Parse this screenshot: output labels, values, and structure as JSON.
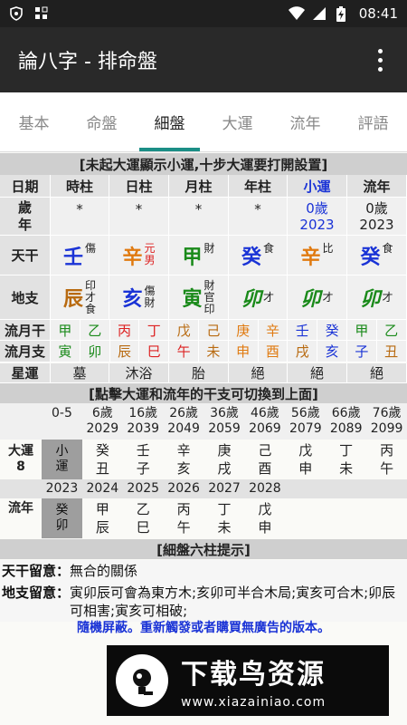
{
  "status": {
    "time": "08:41"
  },
  "app": {
    "title": "論八字 - 排命盤"
  },
  "tabs": [
    "基本",
    "命盤",
    "細盤",
    "大運",
    "流年",
    "評語"
  ],
  "active_tab": 2,
  "notice1": "[未起大運顯示小運,十步大運要打開設置]",
  "pillars": {
    "headers": [
      "日期",
      "時柱",
      "日柱",
      "月柱",
      "年柱",
      "小運",
      "流年"
    ],
    "age_label": "歲年",
    "ages": [
      "*",
      "*",
      "*",
      "*"
    ],
    "xiaoyun": {
      "age": "0歲",
      "year": "2023"
    },
    "liunian": {
      "age": "0歲",
      "year": "2023"
    },
    "tiangan_label": "天干",
    "tiangan": [
      {
        "char": "壬",
        "color": "#1a33d6",
        "sub": "傷",
        "sub2": ""
      },
      {
        "char": "辛",
        "color": "#e07a10",
        "sub": "元",
        "sub2": "男",
        "red": true
      },
      {
        "char": "甲",
        "color": "#1a8a1a",
        "sub": "財",
        "sub2": ""
      },
      {
        "char": "癸",
        "color": "#1a33d6",
        "sub": "食",
        "sub2": ""
      },
      {
        "char": "辛",
        "color": "#e07a10",
        "sub": "比",
        "sub2": ""
      },
      {
        "char": "癸",
        "color": "#1a33d6",
        "sub": "食",
        "sub2": ""
      }
    ],
    "dizhi_label": "地支",
    "dizhi": [
      {
        "char": "辰",
        "color": "#b86a10",
        "sub": [
          "印",
          "才",
          "食"
        ]
      },
      {
        "char": "亥",
        "color": "#1a33d6",
        "sub": [
          "傷",
          "財"
        ]
      },
      {
        "char": "寅",
        "color": "#1a8a1a",
        "sub": [
          "財",
          "官",
          "印"
        ]
      },
      {
        "char": "卯",
        "color": "#1a8a1a",
        "sub": [
          "才"
        ]
      },
      {
        "char": "卯",
        "color": "#1a8a1a",
        "sub": [
          "才"
        ]
      },
      {
        "char": "卯",
        "color": "#1a8a1a",
        "sub": [
          "才"
        ]
      }
    ]
  },
  "flow": {
    "gan_label": "流月干",
    "zhi_label": "流月支",
    "gan": [
      {
        "c": "甲",
        "col": "#1a8a1a"
      },
      {
        "c": "乙",
        "col": "#1a8a1a"
      },
      {
        "c": "丙",
        "col": "#d22"
      },
      {
        "c": "丁",
        "col": "#d22"
      },
      {
        "c": "戊",
        "col": "#b86a10"
      },
      {
        "c": "己",
        "col": "#b86a10"
      },
      {
        "c": "庚",
        "col": "#e07a10"
      },
      {
        "c": "辛",
        "col": "#e07a10"
      },
      {
        "c": "壬",
        "col": "#1a33d6"
      },
      {
        "c": "癸",
        "col": "#1a33d6"
      },
      {
        "c": "甲",
        "col": "#1a8a1a"
      },
      {
        "c": "乙",
        "col": "#1a8a1a"
      }
    ],
    "zhi": [
      {
        "c": "寅",
        "col": "#1a8a1a"
      },
      {
        "c": "卯",
        "col": "#1a8a1a"
      },
      {
        "c": "辰",
        "col": "#b86a10"
      },
      {
        "c": "巳",
        "col": "#d22"
      },
      {
        "c": "午",
        "col": "#d22"
      },
      {
        "c": "未",
        "col": "#b86a10"
      },
      {
        "c": "申",
        "col": "#e07a10"
      },
      {
        "c": "酉",
        "col": "#e07a10"
      },
      {
        "c": "戌",
        "col": "#b86a10"
      },
      {
        "c": "亥",
        "col": "#1a33d6"
      },
      {
        "c": "子",
        "col": "#1a33d6"
      },
      {
        "c": "丑",
        "col": "#b86a10"
      }
    ]
  },
  "xingyun": {
    "label": "星運",
    "values": [
      "墓",
      "沐浴",
      "胎",
      "絕",
      "絕",
      "絕"
    ]
  },
  "notice2": "[點擊大運和流年的干支可切換到上面]",
  "dayun": {
    "ranges": [
      {
        "age": "0-5",
        "year": ""
      },
      {
        "age": "6歲",
        "year": "2029"
      },
      {
        "age": "16歲",
        "year": "2039"
      },
      {
        "age": "26歲",
        "year": "2049"
      },
      {
        "age": "36歲",
        "year": "2059"
      },
      {
        "age": "46歲",
        "year": "2069"
      },
      {
        "age": "56歲",
        "year": "2079"
      },
      {
        "age": "66歲",
        "year": "2089"
      },
      {
        "age": "76歲",
        "year": "2099"
      }
    ],
    "label": "大運",
    "num": "8",
    "first": [
      "小",
      "運"
    ],
    "pillars": [
      [
        "癸",
        "丑"
      ],
      [
        "壬",
        "子"
      ],
      [
        "辛",
        "亥"
      ],
      [
        "庚",
        "戌"
      ],
      [
        "己",
        "酉"
      ],
      [
        "戊",
        "申"
      ],
      [
        "丁",
        "未"
      ],
      [
        "丙",
        "午"
      ]
    ]
  },
  "liunian_row": {
    "years": [
      "2023",
      "2024",
      "2025",
      "2026",
      "2027",
      "2028"
    ],
    "label": "流年",
    "first": [
      "癸",
      "卯"
    ],
    "pillars": [
      [
        "甲",
        "辰"
      ],
      [
        "乙",
        "巳"
      ],
      [
        "丙",
        "午"
      ],
      [
        "丁",
        "未"
      ],
      [
        "戊",
        "申"
      ]
    ]
  },
  "notice3": "[細盤六柱提示]",
  "notes": [
    {
      "k": "天干留意：",
      "v": "無合的關係"
    },
    {
      "k": "地支留意：",
      "v": "寅卯辰可會為東方木;亥卯可半合木局;寅亥可合木;卯辰可相害;寅亥可相破;"
    }
  ],
  "ad_text": "隨機屏蔽。重新觸發或者購買無廣告的版本。",
  "banner": {
    "title": "下载鸟资源",
    "url": "www.xiazainiao.com"
  }
}
